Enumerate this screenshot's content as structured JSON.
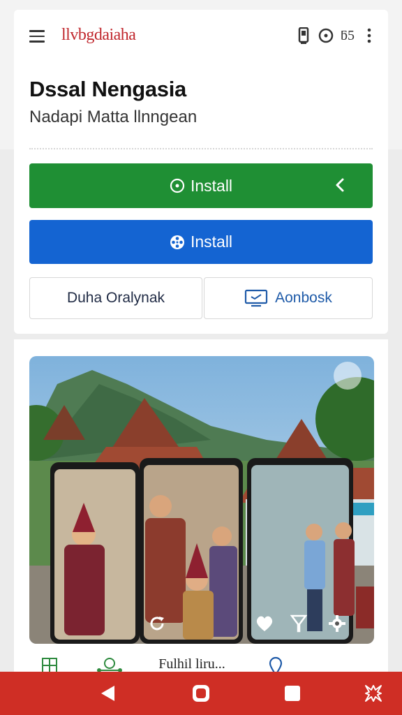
{
  "header": {
    "brand": "llvbgdaiaha",
    "count": "ƃ5",
    "icons": [
      "menu-icon",
      "phone-icon",
      "clock-icon",
      "more-icon"
    ]
  },
  "app": {
    "title": "Dssal Nengasia",
    "subtitle": "Nadapi Matta llnngean"
  },
  "actions": {
    "install_primary": "Install",
    "install_secondary": "Install",
    "left_label": "Duha Oralynak",
    "right_label": "Aonbosk"
  },
  "tabs": [
    {
      "label": ""
    },
    {
      "label": ""
    },
    {
      "label": "Fulhil liru..."
    },
    {
      "label": ""
    }
  ],
  "nav": [
    "back-icon",
    "home-icon",
    "recents-icon",
    "close-icon"
  ],
  "colors": {
    "brand": "#c0272d",
    "green": "#1f8f34",
    "blue": "#1464d2",
    "navbar": "#cf2e25"
  }
}
